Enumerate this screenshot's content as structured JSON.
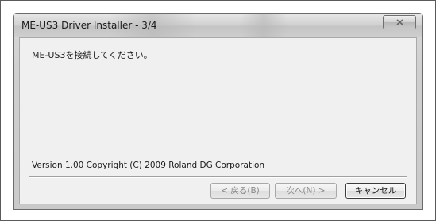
{
  "window": {
    "title": "ME-US3 Driver Installer - 3/4",
    "close_glyph": "✕"
  },
  "content": {
    "message": "ME-US3を接続してください。",
    "version_text": "Version 1.00  Copyright (C) 2009 Roland DG Corporation"
  },
  "buttons": {
    "back_label": "< 戻る(B)",
    "next_label": "次へ(N) >",
    "cancel_label": "キャンセル"
  }
}
